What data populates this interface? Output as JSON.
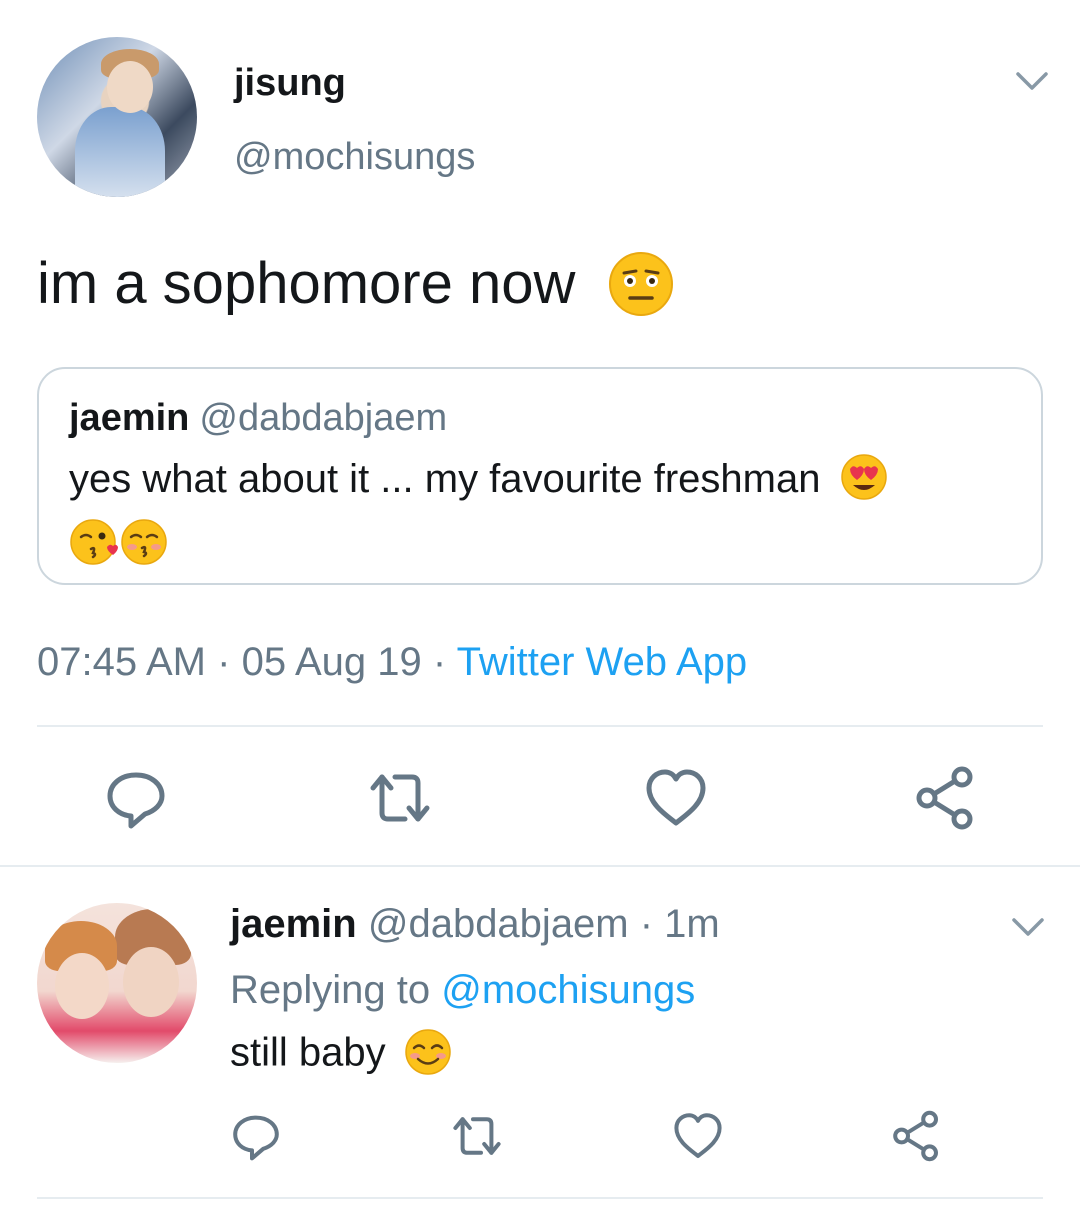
{
  "tweet": {
    "name": "jisung",
    "handle": "@mochisungs",
    "text": "im a sophomore now",
    "text_emoji": "neutral-face-raised-eyebrows",
    "quote": {
      "name": "jaemin",
      "handle": "@dabdabjaem",
      "text": "yes what about it ... my favourite freshman",
      "emojis": [
        "heart-eyes",
        "kissing-wink",
        "kissing-closed-eyes"
      ]
    },
    "time": "07:45 AM",
    "date": "05 Aug 19",
    "sep": "·",
    "source": "Twitter Web App",
    "actions": [
      "reply-icon",
      "retweet-icon",
      "like-icon",
      "share-icon"
    ]
  },
  "reply": {
    "name": "jaemin",
    "handle": "@dabdabjaem",
    "time": "· 1m",
    "replying_to_label": "Replying to",
    "replying_to_handle": "@mochisungs",
    "text": "still baby",
    "text_emoji": "smiling-blush",
    "actions": [
      "reply-icon",
      "retweet-icon",
      "like-icon",
      "share-icon"
    ]
  },
  "colors": {
    "text": "#14171a",
    "secondary": "#657786",
    "link": "#1da1f2",
    "icon": "#657786",
    "border": "#ccd6dd",
    "divider": "#e6ecf0",
    "emoji_face": "#fcc21b"
  }
}
